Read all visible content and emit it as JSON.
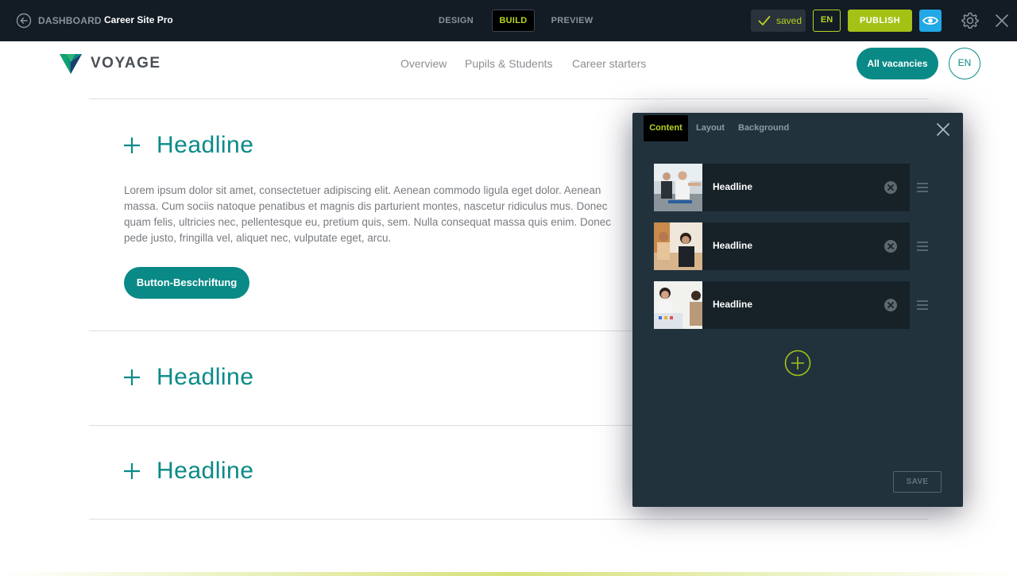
{
  "builder": {
    "back_label": "DASHBOARD",
    "site_title": "Career Site Pro",
    "modes": [
      "DESIGN",
      "BUILD",
      "PREVIEW"
    ],
    "active_mode": "BUILD",
    "status": "saved",
    "language": "EN",
    "publish_label": "PUBLISH",
    "accent_color": "#b7d41f",
    "preview_color": "#22a8e6"
  },
  "site": {
    "brand": "VOYAGE",
    "brand_color": "#0a8a87",
    "nav": [
      "Overview",
      "Pupils & Students",
      "Career starters"
    ],
    "vacancies_label": "All vacancies",
    "language": "EN"
  },
  "accordion": [
    {
      "title": "Headline",
      "expanded": true,
      "body": "Lorem ipsum dolor sit amet, consectetuer adipiscing elit. Aenean commodo ligula eget dolor. Aenean massa. Cum sociis natoque penatibus et magnis dis parturient montes, nascetur ridiculus mus. Donec quam felis, ultricies nec, pellentesque eu, pretium quis, sem. Nulla consequat massa quis enim. Donec pede justo, fringilla vel, aliquet nec, vulputate eget, arcu.",
      "button_label": "Button-Beschriftung"
    },
    {
      "title": "Headline",
      "expanded": false
    },
    {
      "title": "Headline",
      "expanded": false
    }
  ],
  "panel": {
    "tabs": [
      "Content",
      "Layout",
      "Background"
    ],
    "active_tab": "Content",
    "items": [
      {
        "label": "Headline"
      },
      {
        "label": "Headline"
      },
      {
        "label": "Headline"
      }
    ],
    "save_label": "SAVE"
  }
}
